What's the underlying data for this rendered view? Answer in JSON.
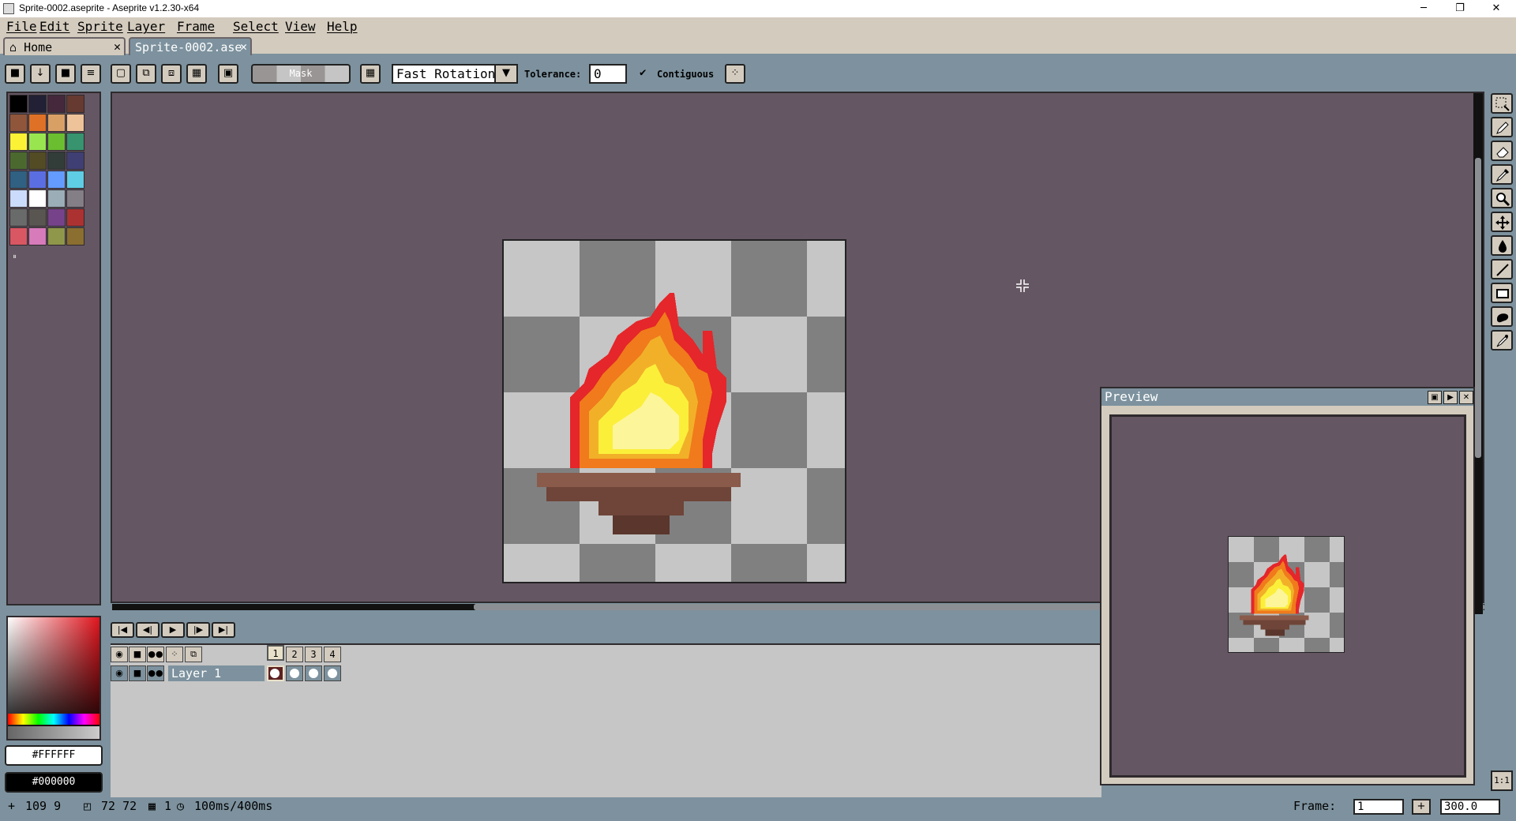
{
  "window": {
    "title": "Sprite-0002.aseprite - Aseprite v1.2.30-x64",
    "minimize": "─",
    "restore": "❐",
    "close": "✕"
  },
  "menu": [
    "File",
    "Edit",
    "Sprite",
    "Layer",
    "Frame",
    "Select",
    "View",
    "Help"
  ],
  "tabs": [
    {
      "label": "Home",
      "close": "✕"
    },
    {
      "label": "Sprite-0002.ase",
      "close": "✕"
    }
  ],
  "context_bar": {
    "mask_label": "Mask",
    "rotation_algorithm": "Fast Rotation",
    "tolerance_label": "Tolerance:",
    "tolerance_value": "0",
    "contiguous_label": "Contiguous",
    "contiguous_check": "✔"
  },
  "palette": {
    "colors": [
      "#000000",
      "#222034",
      "#45283c",
      "#663931",
      "#8f563b",
      "#df7126",
      "#d9a066",
      "#eec39a",
      "#fbf236",
      "#99e550",
      "#6abe30",
      "#37946e",
      "#4b692f",
      "#524b24",
      "#323c39",
      "#3f3f74",
      "#306082",
      "#5b6ee1",
      "#639bff",
      "#5fcde4",
      "#cbdbfc",
      "#ffffff",
      "#9badb7",
      "#847e87",
      "#696a6a",
      "#595652",
      "#76428a",
      "#ac3232",
      "#d95763",
      "#d77bba",
      "#8f974a",
      "#8a6f30"
    ]
  },
  "color_chips": {
    "foreground": "#FFFFFF",
    "background": "#000000"
  },
  "preview": {
    "title": "Preview"
  },
  "timeline": {
    "frames": [
      "1",
      "2",
      "3",
      "4"
    ],
    "layer_name": "Layer 1"
  },
  "status": {
    "cursor": "109 9",
    "size": "72 72",
    "frame_count": "1",
    "duration": "100ms/400ms",
    "frame_label": "Frame:",
    "frame_value": "1",
    "zoom_value": "300.0",
    "one_to_one": "1:1"
  }
}
